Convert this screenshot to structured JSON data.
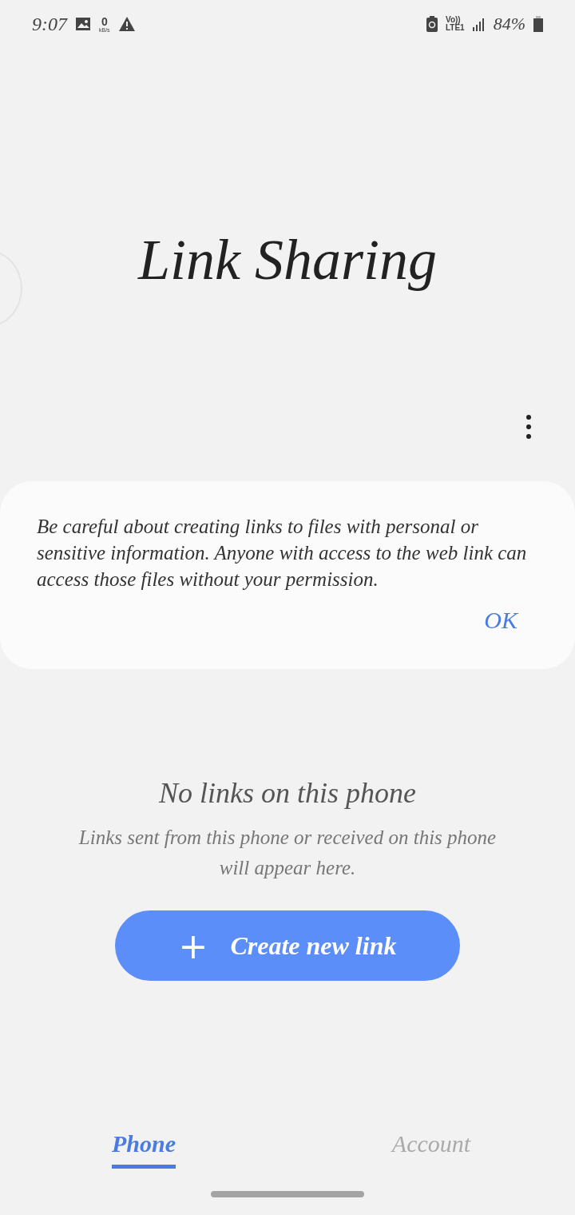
{
  "status_bar": {
    "time": "9:07",
    "speed_value": "0",
    "speed_unit": "kB/s",
    "volte": "Vo))",
    "network": "LTE1",
    "battery": "84%"
  },
  "title": "Link Sharing",
  "dialog": {
    "message": "Be careful about creating links to files with personal or sensitive information. Anyone with access to the web link can access those files without your permission.",
    "button": "OK"
  },
  "empty_state": {
    "title": "No links on this phone",
    "subtitle": "Links sent from this phone or received on this phone will appear here."
  },
  "create_button": {
    "icon": "+",
    "label": "Create new link"
  },
  "tabs": [
    {
      "label": "Phone",
      "selected": true
    },
    {
      "label": "Account",
      "selected": false
    }
  ]
}
